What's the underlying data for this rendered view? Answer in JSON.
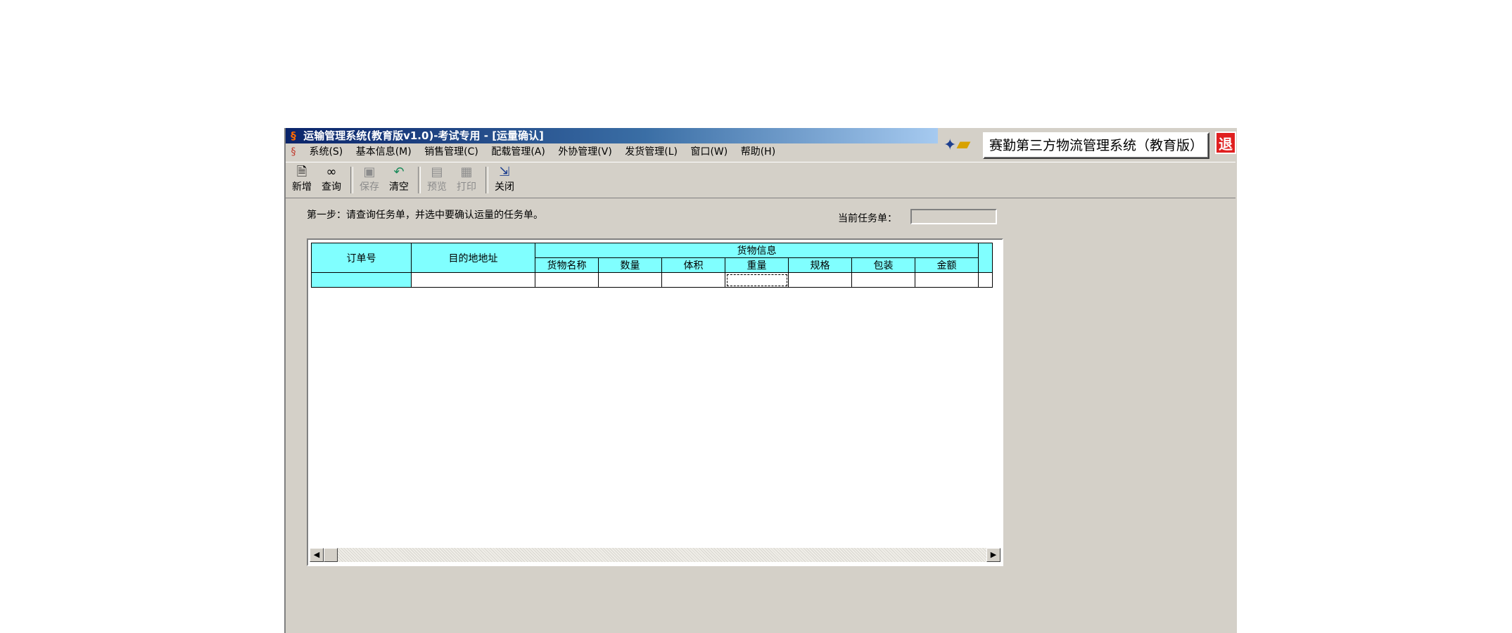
{
  "window": {
    "title": "运输管理系统(教育版v1.0)-考试专用 - [运量确认]",
    "brand_title": "赛勤第三方物流管理系统（教育版）",
    "exit_label": "退"
  },
  "menu": [
    {
      "label": "系统(S)"
    },
    {
      "label": "基本信息(M)"
    },
    {
      "label": "销售管理(C)"
    },
    {
      "label": "配载管理(A)"
    },
    {
      "label": "外协管理(V)"
    },
    {
      "label": "发货管理(L)"
    },
    {
      "label": "窗口(W)"
    },
    {
      "label": "帮助(H)"
    }
  ],
  "toolbar": [
    {
      "label": "新增",
      "icon": "new-icon",
      "enabled": true
    },
    {
      "label": "查询",
      "icon": "binoculars-icon",
      "enabled": true
    },
    {
      "label": "保存",
      "icon": "save-icon",
      "enabled": false
    },
    {
      "label": "清空",
      "icon": "undo-icon",
      "enabled": true
    },
    {
      "label": "预览",
      "icon": "preview-icon",
      "enabled": false
    },
    {
      "label": "打印",
      "icon": "print-icon",
      "enabled": false
    },
    {
      "label": "关闭",
      "icon": "close-icon",
      "enabled": true
    }
  ],
  "step_text": "第一步：请查询任务单，并选中要确认运量的任务单。",
  "current_task": {
    "label": "当前任务单：",
    "value": ""
  },
  "grid": {
    "col_order": "订单号",
    "col_address": "目的地地址",
    "group_goods": "货物信息",
    "sub_columns": [
      "货物名称",
      "数量",
      "体积",
      "重量",
      "规格",
      "包装",
      "金额"
    ]
  },
  "colors": {
    "header_bg": "#80ffff",
    "window_bg": "#d4d0c8",
    "title_gradient_start": "#0a246a"
  }
}
